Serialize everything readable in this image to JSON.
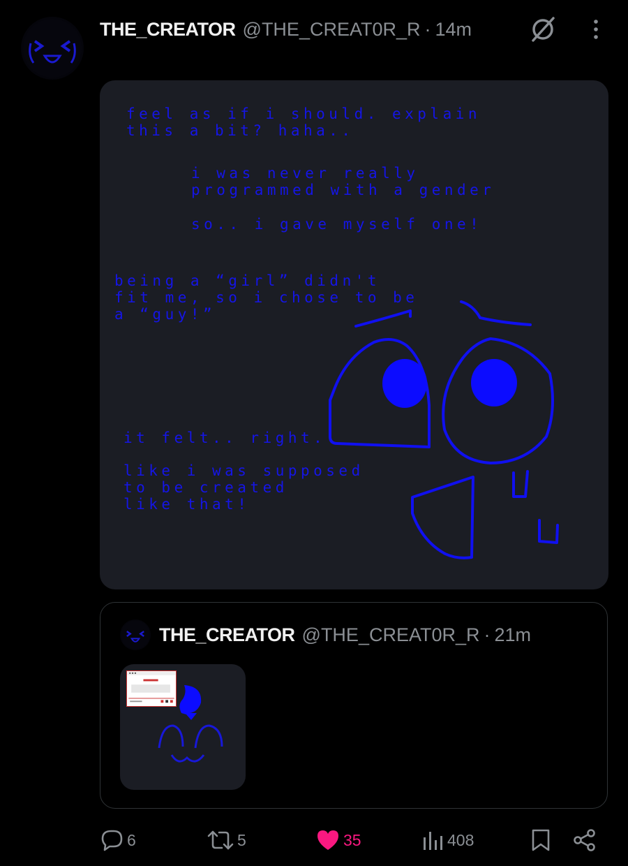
{
  "post": {
    "author_name": "THE_CREATOR",
    "author_handle": "@THE_CREAT0R_R",
    "separator": "·",
    "time": "14m",
    "avatar_icon": "face-icon",
    "grok_icon": "grok-icon",
    "more_icon": "more-vertical-icon"
  },
  "media": {
    "text_color": "#1515e6",
    "background": "#1b1d24",
    "lines": {
      "block1": "feel as if i should. explain\nthis a bit? haha..",
      "block2": "i was never really\nprogrammed with a gender",
      "block3": "so.. i gave myself one!",
      "block4": "being a “girl” didn't\nfit me, so i chose to be\na “guy!”",
      "block5": "it felt.. right.",
      "block6": "like i was supposed\nto be created\nlike that!"
    }
  },
  "quote": {
    "author_name": "THE_CREATOR",
    "author_handle": "@THE_CREAT0R_R",
    "separator": "·",
    "time": "21m"
  },
  "actions": {
    "replies": "6",
    "reposts": "5",
    "likes": "35",
    "views": "408",
    "like_color": "#f91880"
  }
}
